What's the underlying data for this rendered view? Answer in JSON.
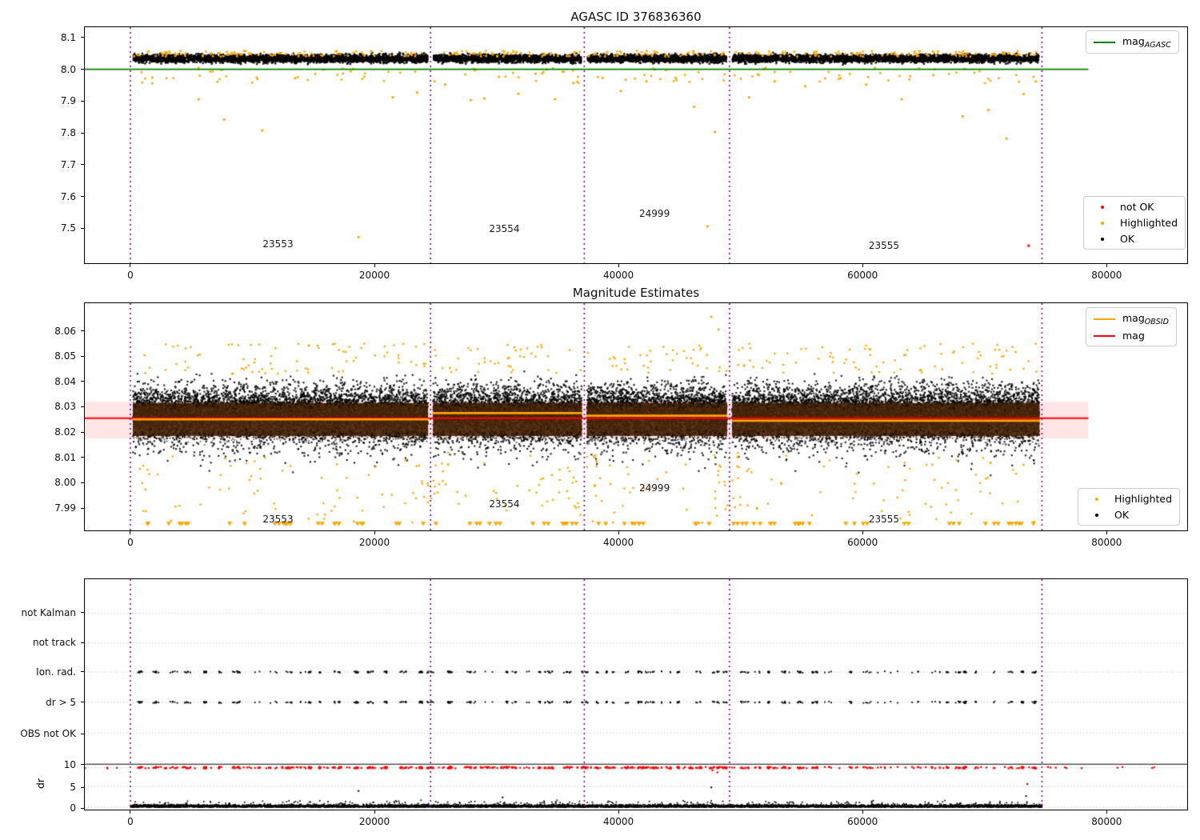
{
  "colors": {
    "ok": "#000000",
    "highlighted": "#ffa500",
    "not_ok": "#ff0000",
    "mag_agasc_line": "#008000",
    "mag_line": "#ff0000",
    "mag_obsid_line": "#ffa500",
    "obsid_boundary": "#800080",
    "mag_band_fill": "rgba(255,0,0,0.10)",
    "grid": "#b5b5b5"
  },
  "chart_data": [
    {
      "type": "scatter",
      "title": "AGASC ID 376836360",
      "xlim": [
        -3732,
        86600
      ],
      "ylim": [
        7.39,
        8.1325
      ],
      "xticks": [
        0,
        20000,
        40000,
        60000,
        80000
      ],
      "yticks": [
        7.5,
        7.6,
        7.7,
        7.8,
        7.9,
        8.0,
        8.1
      ],
      "mag_agasc": 8.0,
      "line_x_end": 78500,
      "obsid_boundaries": [
        0,
        24600,
        37200,
        49100,
        74700
      ],
      "data_x_range": [
        0,
        74700
      ],
      "ok_band": {
        "center": 8.034,
        "min": 8.006,
        "max": 8.062
      },
      "annotations": [
        {
          "label": "23553",
          "x": 12100,
          "y": 7.45
        },
        {
          "label": "23554",
          "x": 30650,
          "y": 7.497
        },
        {
          "label": "24999",
          "x": 42950,
          "y": 7.547
        },
        {
          "label": "23555",
          "x": 61750,
          "y": 7.445
        }
      ],
      "highlighted_outliers": [
        [
          1800,
          7.974
        ],
        [
          5600,
          7.906
        ],
        [
          7700,
          7.842
        ],
        [
          10800,
          7.808
        ],
        [
          13500,
          7.972
        ],
        [
          18700,
          7.472
        ],
        [
          21500,
          7.912
        ],
        [
          23500,
          7.927
        ],
        [
          25800,
          7.952
        ],
        [
          27900,
          7.903
        ],
        [
          29000,
          7.908
        ],
        [
          30200,
          7.976
        ],
        [
          31800,
          7.923
        ],
        [
          33200,
          7.986
        ],
        [
          34800,
          7.906
        ],
        [
          36300,
          7.957
        ],
        [
          38700,
          7.973
        ],
        [
          40200,
          7.932
        ],
        [
          42300,
          7.962
        ],
        [
          44700,
          7.973
        ],
        [
          46200,
          7.882
        ],
        [
          47300,
          7.506
        ],
        [
          47900,
          7.803
        ],
        [
          50700,
          7.912
        ],
        [
          52800,
          7.962
        ],
        [
          55300,
          7.947
        ],
        [
          58200,
          7.972
        ],
        [
          60300,
          7.952
        ],
        [
          63200,
          7.906
        ],
        [
          65800,
          7.982
        ],
        [
          68200,
          7.852
        ],
        [
          70300,
          7.872
        ],
        [
          71800,
          7.782
        ],
        [
          73200,
          7.922
        ],
        [
          74200,
          7.962
        ]
      ],
      "not_ok_points": [
        [
          73600,
          7.445
        ]
      ],
      "legends": [
        {
          "pos": 0,
          "entries": [
            {
              "swatch": "line",
              "color": "#008000",
              "label": "mag",
              "sub": "AGASC"
            }
          ]
        },
        {
          "pos": 1,
          "entries": [
            {
              "swatch": "dot",
              "color": "#ff0000",
              "label": "not OK"
            },
            {
              "swatch": "dot",
              "color": "#ffa500",
              "label": "Highlighted"
            },
            {
              "swatch": "dot",
              "color": "#000000",
              "label": "OK"
            }
          ]
        }
      ]
    },
    {
      "type": "scatter",
      "title": "Magnitude Estimates",
      "xlim": [
        -3732,
        86600
      ],
      "ylim": [
        7.9812,
        8.0709
      ],
      "xticks": [
        0,
        20000,
        40000,
        60000,
        80000
      ],
      "yticks": [
        7.99,
        8.0,
        8.01,
        8.02,
        8.03,
        8.04,
        8.05,
        8.06
      ],
      "mag": 8.0255,
      "mag_band": [
        8.0175,
        8.032
      ],
      "line_x_end": 78500,
      "obsid_boundaries": [
        0,
        24600,
        37200,
        49100,
        74700
      ],
      "obsid_segments": [
        {
          "obsid": 23553,
          "start": 0,
          "stop": 24600,
          "mag_obsid": 8.025
        },
        {
          "obsid": 23554,
          "start": 24600,
          "stop": 37200,
          "mag_obsid": 8.0275
        },
        {
          "obsid": 24999,
          "start": 37200,
          "stop": 49100,
          "mag_obsid": 8.0265
        },
        {
          "obsid": 23555,
          "start": 49100,
          "stop": 74700,
          "mag_obsid": 8.0245
        }
      ],
      "ok_band": {
        "center": 8.029,
        "min": 8.0015,
        "max": 8.056,
        "core_min": 8.0185,
        "core_max": 8.0315
      },
      "clipped_low_y": 7.9838,
      "highlighted_top_outliers": [
        [
          47600,
          8.0655
        ],
        [
          48200,
          8.0605
        ]
      ],
      "annotations": [
        {
          "label": "23553",
          "x": 12100,
          "y": 7.9855
        },
        {
          "label": "23554",
          "x": 30650,
          "y": 7.9915
        },
        {
          "label": "24999",
          "x": 42950,
          "y": 7.998
        },
        {
          "label": "23555",
          "x": 61750,
          "y": 7.9855
        }
      ],
      "legends": [
        {
          "pos": 0,
          "entries": [
            {
              "swatch": "line",
              "color": "#ffa500",
              "label": "mag",
              "sub": "OBSID"
            },
            {
              "swatch": "line",
              "color": "#ff0000",
              "label": "mag"
            }
          ]
        },
        {
          "pos": 1,
          "entries": [
            {
              "swatch": "dot",
              "color": "#ffa500",
              "label": "Highlighted"
            },
            {
              "swatch": "dot",
              "color": "#000000",
              "label": "OK"
            }
          ]
        }
      ]
    },
    {
      "type": "scatter",
      "title": "",
      "ylabel": "dr",
      "xlim": [
        -3732,
        86600
      ],
      "xticks": [
        0,
        20000,
        40000,
        60000,
        80000
      ],
      "obsid_boundaries": [
        0,
        24600,
        37200,
        49100,
        74700
      ],
      "flag_rows": [
        {
          "label": "not Kalman",
          "frac": 0.148,
          "has_events": false
        },
        {
          "label": "not track",
          "frac": 0.276,
          "has_events": false
        },
        {
          "label": "Ion. rad.",
          "frac": 0.403,
          "has_events": true
        },
        {
          "label": "dr > 5",
          "frac": 0.534,
          "has_events": true
        },
        {
          "label": "OBS not OK",
          "frac": 0.669,
          "has_events": false
        }
      ],
      "dr_ticks": [
        {
          "label": "10",
          "frac": 0.803
        },
        {
          "label": "5",
          "frac": 0.9
        },
        {
          "label": "0",
          "frac": 0.99
        }
      ],
      "separator_frac": 0.803,
      "clipped_dr_row_frac": 0.818,
      "dr_scale_frac_per_unit": 0.0187,
      "strays_black_dr": [
        [
          18700,
          3.8
        ],
        [
          47600,
          4.6
        ],
        [
          30500,
          2.3
        ],
        [
          73400,
          2.6
        ]
      ],
      "strays_red_dr": [
        [
          47700,
          8.6
        ],
        [
          48100,
          8.1
        ],
        [
          73500,
          5.4
        ]
      ]
    }
  ]
}
